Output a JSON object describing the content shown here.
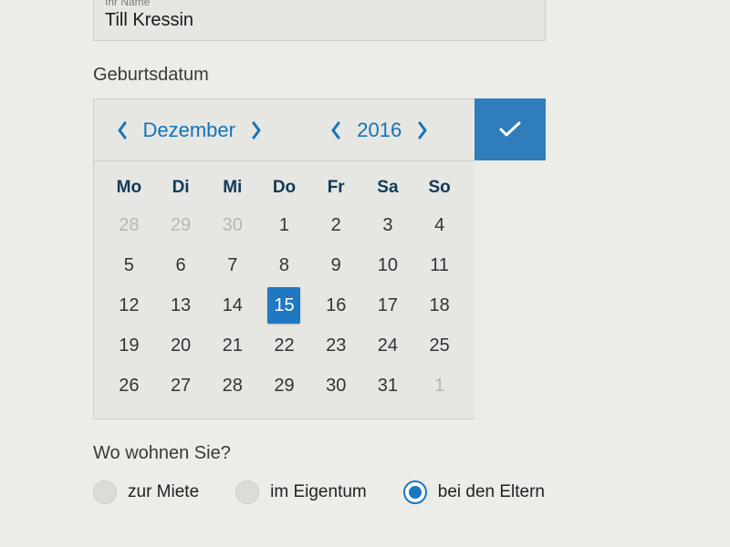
{
  "name_field": {
    "label": "Ihr Name",
    "value": "Till Kressin"
  },
  "birthdate_label": "Geburtsdatum",
  "calendar": {
    "month": "Dezember",
    "year": "2016",
    "dow": [
      "Mo",
      "Di",
      "Mi",
      "Do",
      "Fr",
      "Sa",
      "So"
    ],
    "selected_day": 15,
    "leading_out": [
      28,
      29,
      30
    ],
    "days": [
      1,
      2,
      3,
      4,
      5,
      6,
      7,
      8,
      9,
      10,
      11,
      12,
      13,
      14,
      15,
      16,
      17,
      18,
      19,
      20,
      21,
      22,
      23,
      24,
      25,
      26,
      27,
      28,
      29,
      30,
      31
    ],
    "trailing_out": [
      1
    ]
  },
  "residence": {
    "question": "Wo wohnen Sie?",
    "options": [
      {
        "label": "zur Miete",
        "selected": false
      },
      {
        "label": "im Eigentum",
        "selected": false
      },
      {
        "label": "bei den Eltern",
        "selected": true
      }
    ]
  },
  "colors": {
    "accent": "#1f78c1"
  }
}
